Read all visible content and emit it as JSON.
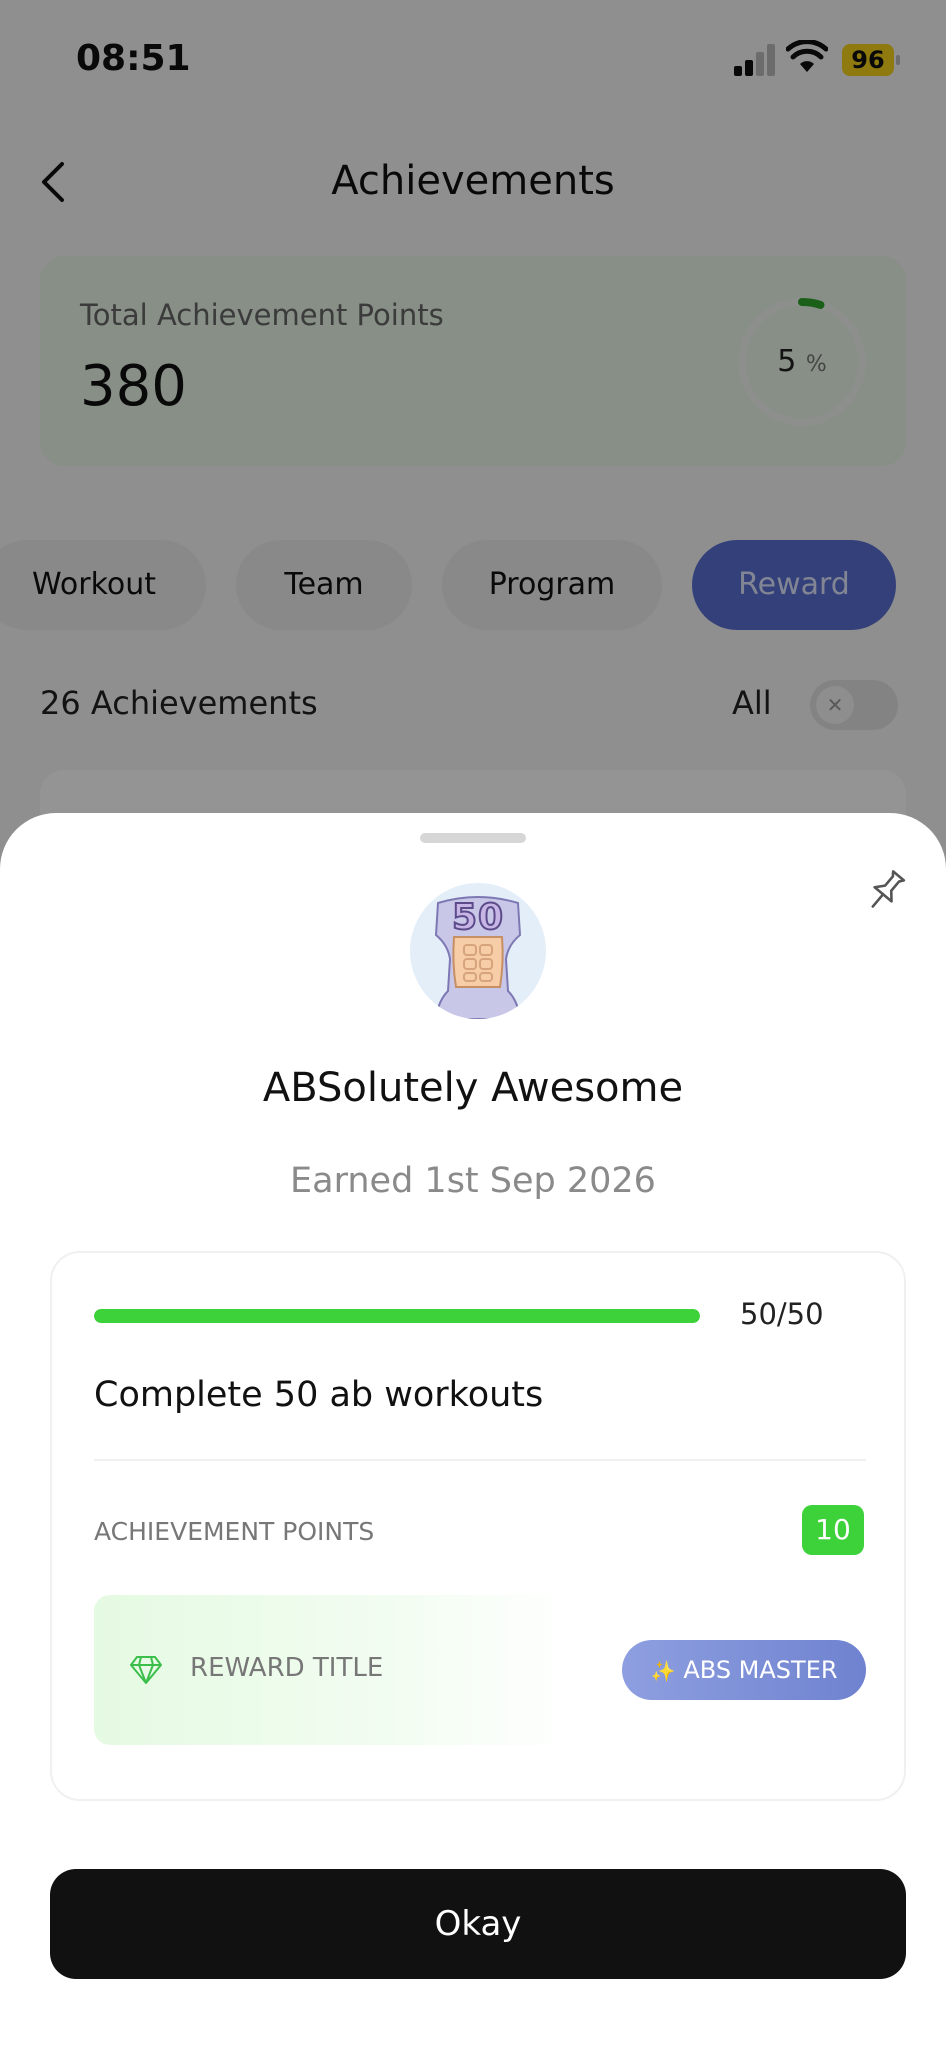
{
  "status_bar": {
    "time": "08:51",
    "battery": "96"
  },
  "header": {
    "title": "Achievements"
  },
  "summary": {
    "label": "Total Achievement Points",
    "points": "380",
    "percent": "5",
    "percent_unit": "%"
  },
  "tabs": [
    {
      "label": "Workout",
      "active": false
    },
    {
      "label": "Team",
      "active": false
    },
    {
      "label": "Program",
      "active": false
    },
    {
      "label": "Reward",
      "active": true
    }
  ],
  "list": {
    "count_label": "26 Achievements",
    "filter_label": "All",
    "toggle_icon": "close-icon"
  },
  "sheet": {
    "badge_number": "50",
    "title": "ABSolutely Awesome",
    "earned": "Earned 1st Sep 2026",
    "progress": {
      "value": 50,
      "max": 50,
      "text": "50/50"
    },
    "task": "Complete 50 ab workouts",
    "points_label": "ACHIEVEMENT POINTS",
    "points_value": "10",
    "reward_label": "REWARD TITLE",
    "reward_value": "ABS MASTER",
    "reward_icon": "sparkles-icon",
    "okay_label": "Okay"
  },
  "colors": {
    "accent_green": "#3dd13a",
    "reward_tab": "#5a6fd0",
    "summary_card": "#e9f6e8",
    "button": "#111111"
  }
}
